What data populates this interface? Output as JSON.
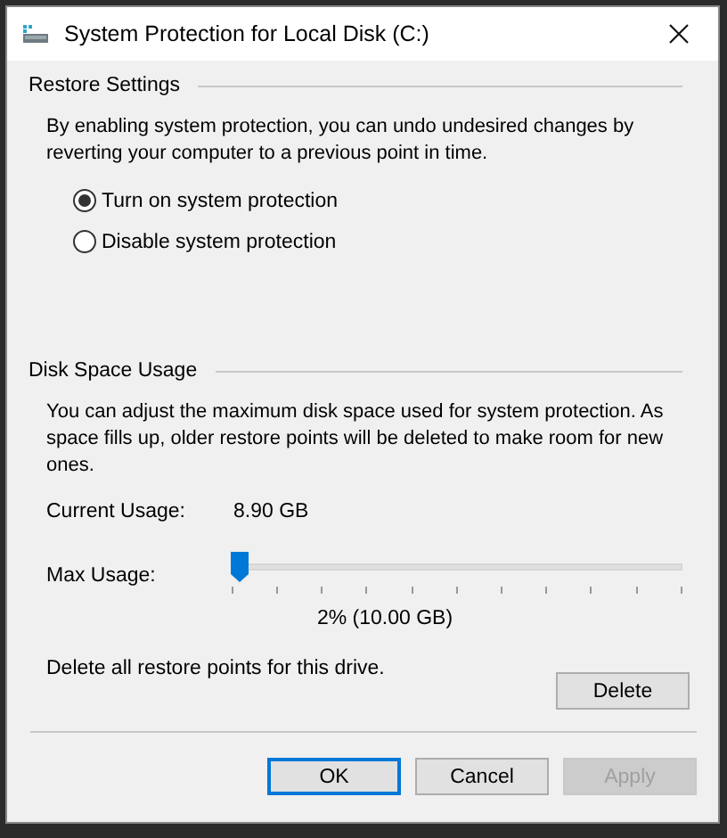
{
  "window": {
    "title": "System Protection for Local Disk (C:)"
  },
  "restore_settings": {
    "heading": "Restore Settings",
    "description": "By enabling system protection, you can undo undesired changes by reverting your computer to a previous point in time.",
    "options": [
      {
        "label": "Turn on system protection",
        "selected": true
      },
      {
        "label": "Disable system protection",
        "selected": false
      }
    ]
  },
  "disk_space_usage": {
    "heading": "Disk Space Usage",
    "description": "You can adjust the maximum disk space used for system protection. As space fills up, older restore points will be deleted to make room for new ones.",
    "current_usage_label": "Current Usage:",
    "current_usage_value": "8.90 GB",
    "max_usage_label": "Max Usage:",
    "max_usage": {
      "level": 0.02
    },
    "max_usage_reading": "2% (10.00 GB)",
    "delete_text": "Delete all restore points for this drive.",
    "delete_button": "Delete"
  },
  "buttons": [
    {
      "label": "OK",
      "default": true,
      "disabled": false
    },
    {
      "label": "Cancel",
      "default": false,
      "disabled": false
    },
    {
      "label": "Apply",
      "default": false,
      "disabled": true
    }
  ]
}
